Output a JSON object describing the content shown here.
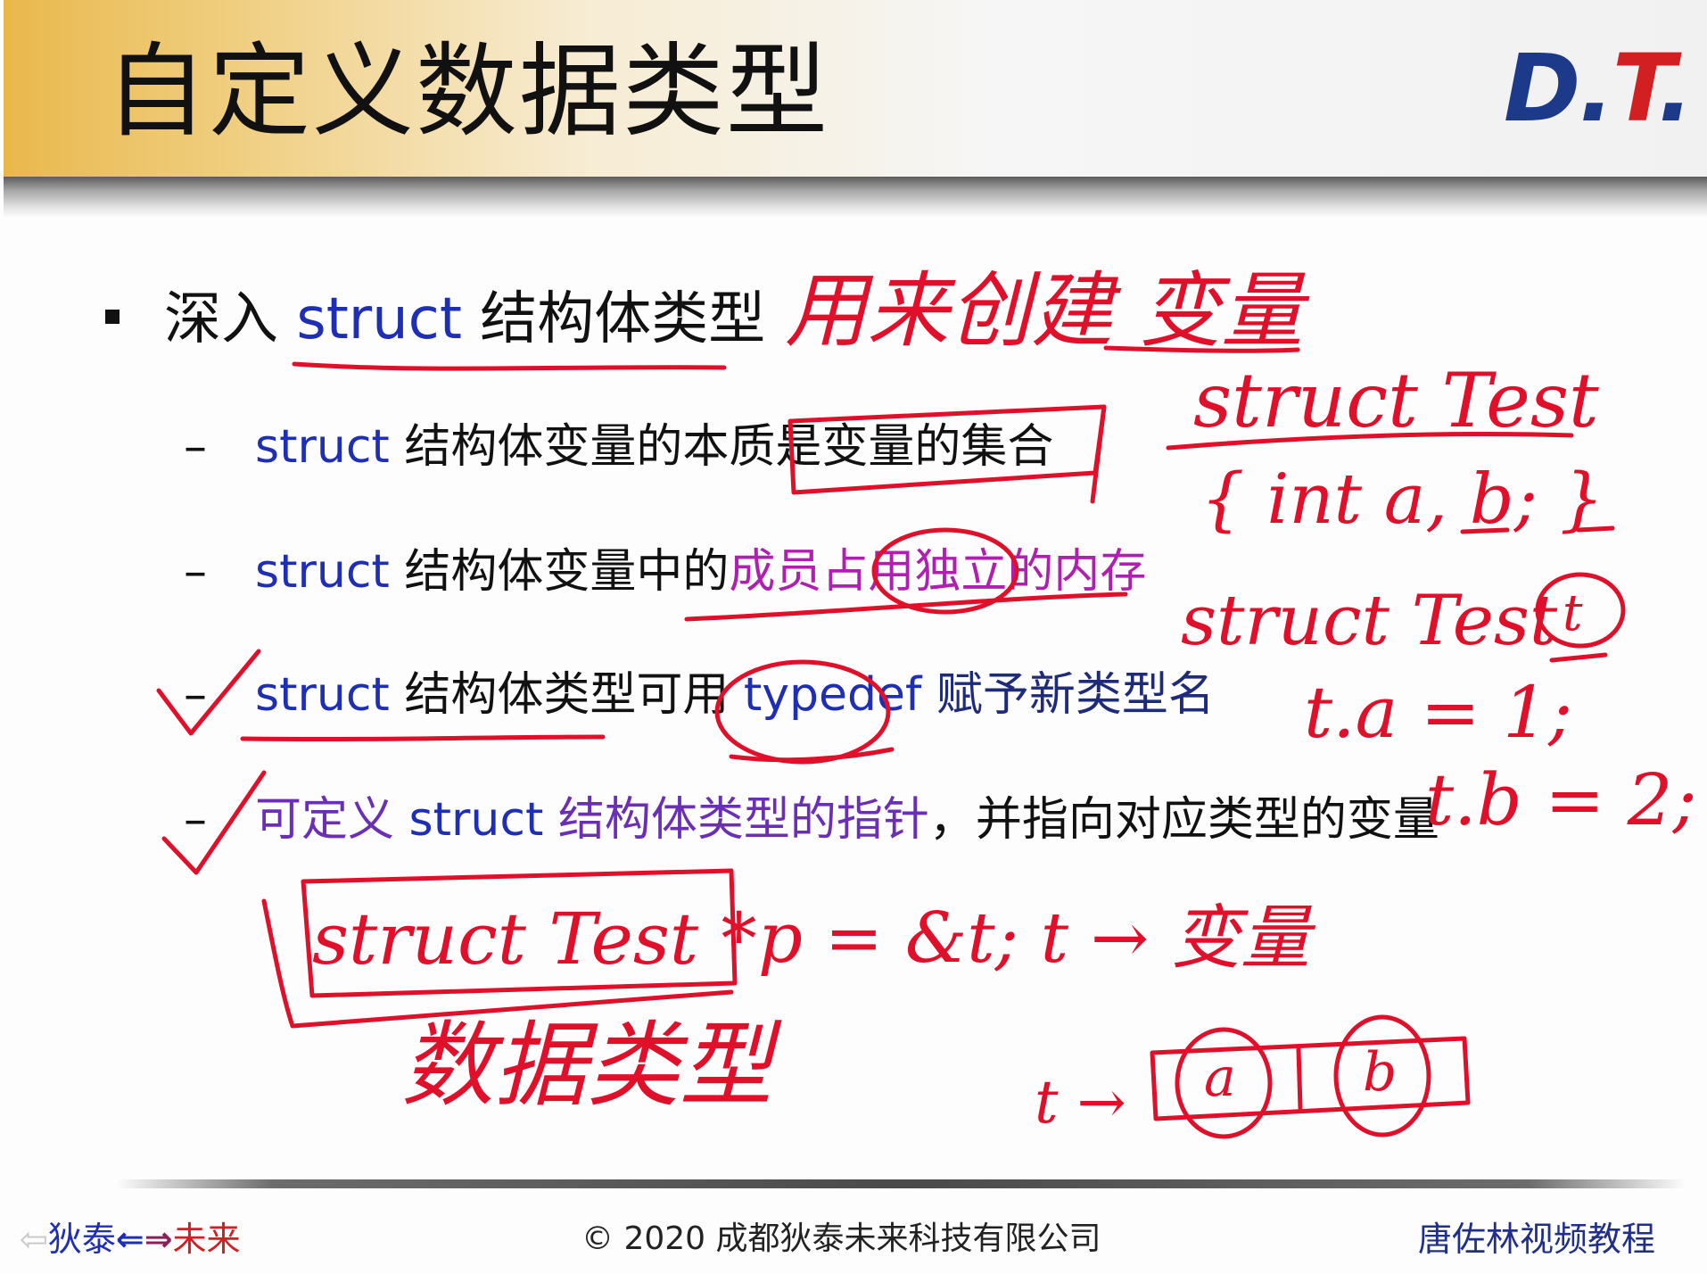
{
  "slide": {
    "title": "自定义数据类型",
    "logo": {
      "d": "D",
      "dot1": ".",
      "t": "T",
      "dot2": "."
    }
  },
  "bullets": {
    "main": {
      "pre": "深入 ",
      "kw": "struct",
      "post": " 结构体类型"
    },
    "sub1": {
      "kw": "struct",
      "text": " 结构体变量的本质是变量的集合"
    },
    "sub2": {
      "kw": "struct",
      "text": " 结构体变量中的",
      "highlight": "成员占用独立的内存"
    },
    "sub3": {
      "kw": "struct",
      "text": " 结构体类型可用 ",
      "kw2": "typedef",
      "post": " 赋予新类型名"
    },
    "sub4": {
      "pre": "可定义 ",
      "kw": "struct",
      "mid": " 结构体类型的指针",
      "post": "，并指向对应类型的变量"
    }
  },
  "annotations": {
    "note_top": "用来创建 变量",
    "code1": "struct Test",
    "code2": "{ int a, b; }",
    "code3": "struct Test",
    "code3_var": "t",
    "code4": "t.a = 1;",
    "code5": "t.b = 2;",
    "code6_box": "struct Test *",
    "code6_rest": "p = &t;  t → 变量",
    "note_bottom": "数据类型",
    "mem_prefix": "t →",
    "mem_a": "a",
    "mem_b": "b",
    "ink_color": "#e0102a"
  },
  "footer": {
    "left_a": "狄泰",
    "left_arrows_l": "⇐",
    "left_arrows_r": "⇒",
    "left_b": "未来",
    "copyright": "© 2020 成都狄泰未来科技有限公司",
    "right": "唐佐林视频教程"
  },
  "colors": {
    "keyword": "#1f2fb5",
    "highlight_purple": "#b020b0",
    "highlight_violet": "#6a2fb5",
    "accent_red": "#d11f22",
    "header_gold": "#e9b84c"
  }
}
